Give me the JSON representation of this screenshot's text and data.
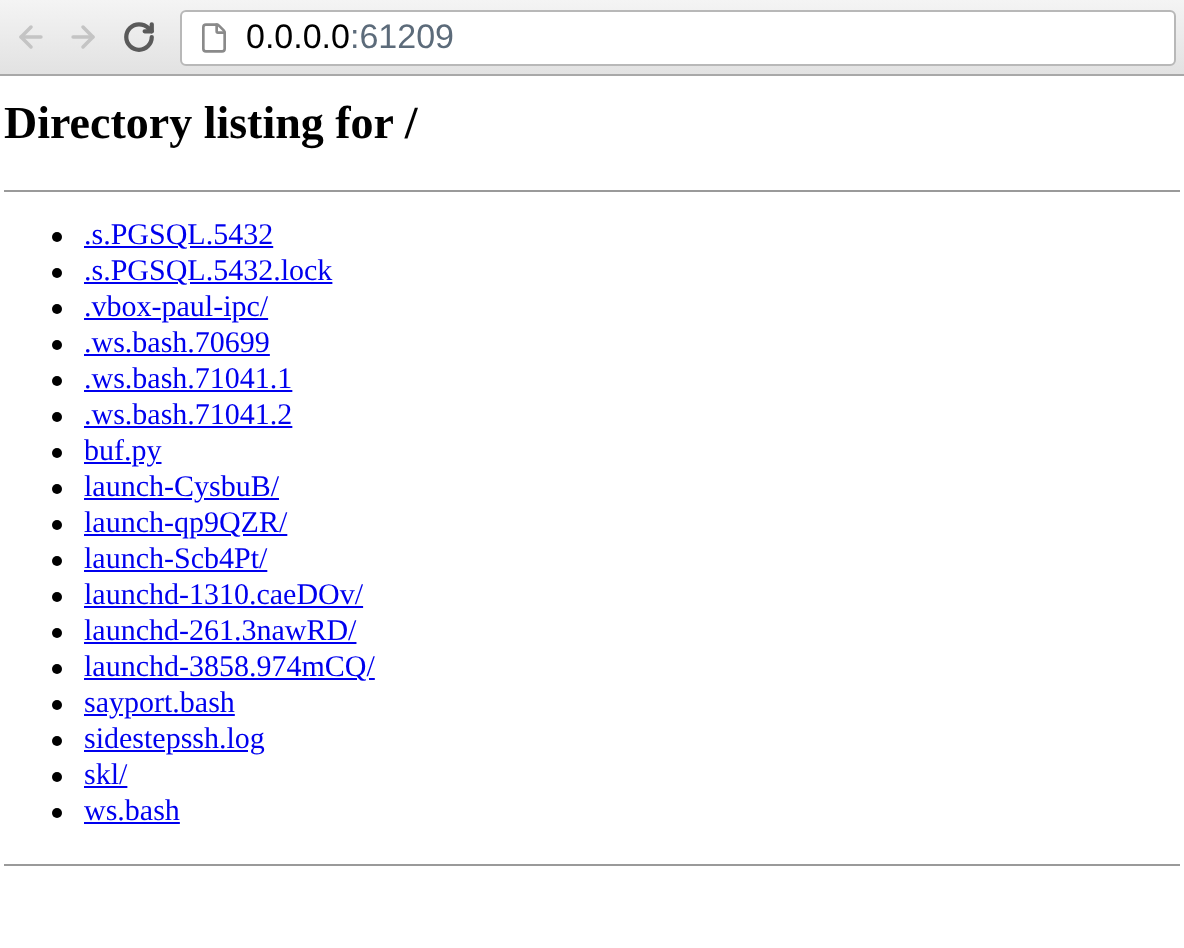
{
  "toolbar": {
    "back": {
      "disabled": true
    },
    "forward": {
      "disabled": true
    },
    "address": {
      "host": "0.0.0.0",
      "port": ":61209"
    }
  },
  "heading": "Directory listing for /",
  "files": [
    ".s.PGSQL.5432",
    ".s.PGSQL.5432.lock",
    ".vbox-paul-ipc/",
    ".ws.bash.70699",
    ".ws.bash.71041.1",
    ".ws.bash.71041.2",
    "buf.py",
    "launch-CysbuB/",
    "launch-qp9QZR/",
    "launch-Scb4Pt/",
    "launchd-1310.caeDOv/",
    "launchd-261.3nawRD/",
    "launchd-3858.974mCQ/",
    "sayport.bash",
    "sidestepssh.log",
    "skl/",
    "ws.bash"
  ]
}
